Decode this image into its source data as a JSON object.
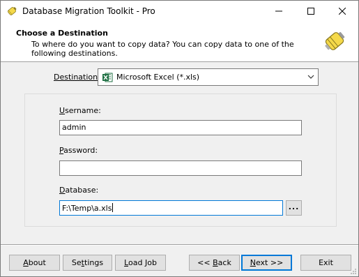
{
  "window": {
    "title": "Database Migration Toolkit - Pro",
    "app_icon": "battery-icon"
  },
  "header": {
    "title": "Choose a Destination",
    "description": "To where do you want to copy data? You can copy data to one of the following destinations.",
    "icon": "battery-icon"
  },
  "destination": {
    "label_prefix": "Destination",
    "label_suffix": ":",
    "value": "Microsoft Excel (*.xls)",
    "icon": "excel-icon"
  },
  "fields": {
    "username": {
      "label_accel": "U",
      "label_rest": "sername:",
      "value": "admin"
    },
    "password": {
      "label_accel": "P",
      "label_rest": "assword:",
      "value": ""
    },
    "database": {
      "label_accel": "D",
      "label_rest": "atabase:",
      "value": "F:\\Temp\\a.xls",
      "browse_label": "..."
    }
  },
  "buttons": {
    "about": {
      "accel": "A",
      "rest": "bout"
    },
    "settings": {
      "pre": "Se",
      "accel": "t",
      "rest": "tings"
    },
    "load_job": {
      "accel": "L",
      "rest": "oad Job"
    },
    "back": {
      "pre": "<< ",
      "accel": "B",
      "rest": "ack"
    },
    "next": {
      "accel": "N",
      "rest": "ext >>"
    },
    "exit": {
      "label": "Exit"
    }
  },
  "colors": {
    "focus_border": "#0078d7",
    "excel_green": "#1d6f42",
    "icon_yellow": "#f5d94a"
  }
}
